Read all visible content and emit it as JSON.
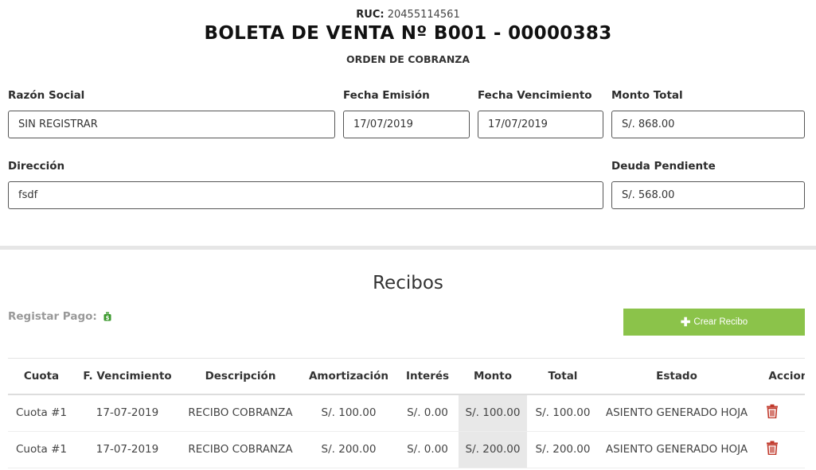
{
  "header": {
    "ruc_label": "RUC:",
    "ruc_value": "20455114561",
    "title": "BOLETA DE VENTA Nº B001 - 00000383",
    "subtitle": "ORDEN DE COBRANZA"
  },
  "form": {
    "razon_social": {
      "label": "Razón Social",
      "value": "SIN REGISTRAR"
    },
    "fecha_emision": {
      "label": "Fecha Emisión",
      "value": "17/07/2019"
    },
    "fecha_vencimiento": {
      "label": "Fecha Vencimiento",
      "value": "17/07/2019"
    },
    "monto_total": {
      "label": "Monto Total",
      "value": "S/. 868.00"
    },
    "direccion": {
      "label": "Dirección",
      "value": "fsdf"
    },
    "deuda_pendiente": {
      "label": "Deuda Pendiente",
      "value": "S/. 568.00"
    }
  },
  "recibos": {
    "title": "Recibos",
    "registrar_pago_label": "Registar Pago:",
    "crear_recibo_label": "Crear Recibo",
    "columns": [
      "Cuota",
      "F. Vencimiento",
      "Descripción",
      "Amortización",
      "Interés",
      "Monto",
      "Total",
      "Estado",
      "Acciones"
    ],
    "rows": [
      {
        "cuota": "Cuota #1",
        "vencimiento": "17-07-2019",
        "descripcion": "RECIBO COBRANZA",
        "amortizacion": "S/. 100.00",
        "interes": "S/. 0.00",
        "monto": "S/. 100.00",
        "total": "S/. 100.00",
        "estado": "ASIENTO GENERADO HOJA"
      },
      {
        "cuota": "Cuota #1",
        "vencimiento": "17-07-2019",
        "descripcion": "RECIBO COBRANZA",
        "amortizacion": "S/. 200.00",
        "interes": "S/. 0.00",
        "monto": "S/. 200.00",
        "total": "S/. 200.00",
        "estado": "ASIENTO GENERADO HOJA"
      }
    ]
  },
  "colors": {
    "accent_green": "#8bc34a",
    "icon_green": "#3c9a2e",
    "delete_red": "#c0392b"
  },
  "icons": {
    "money": "money-bag-icon",
    "plus": "plus-icon",
    "delete": "trash-icon"
  }
}
